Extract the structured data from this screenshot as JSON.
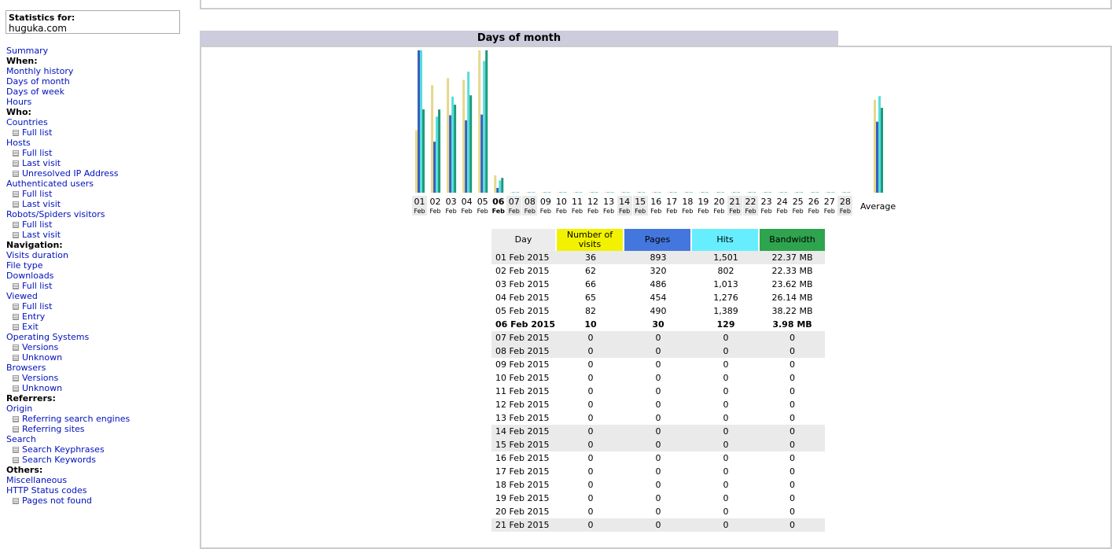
{
  "stats_for": {
    "label": "Statistics for:",
    "site": "huguka.com"
  },
  "nav": [
    {
      "text": "Summary",
      "type": "link"
    },
    {
      "text": "When:",
      "type": "head"
    },
    {
      "text": "Monthly history",
      "type": "link"
    },
    {
      "text": "Days of month",
      "type": "link"
    },
    {
      "text": "Days of week",
      "type": "link"
    },
    {
      "text": "Hours",
      "type": "link"
    },
    {
      "text": "Who:",
      "type": "head"
    },
    {
      "text": "Countries",
      "type": "link"
    },
    {
      "text": "Full list",
      "type": "sub"
    },
    {
      "text": "Hosts",
      "type": "link"
    },
    {
      "text": "Full list",
      "type": "sub"
    },
    {
      "text": "Last visit",
      "type": "sub"
    },
    {
      "text": "Unresolved IP Address",
      "type": "sub"
    },
    {
      "text": "Authenticated users",
      "type": "link"
    },
    {
      "text": "Full list",
      "type": "sub"
    },
    {
      "text": "Last visit",
      "type": "sub"
    },
    {
      "text": "Robots/Spiders visitors",
      "type": "link"
    },
    {
      "text": "Full list",
      "type": "sub"
    },
    {
      "text": "Last visit",
      "type": "sub"
    },
    {
      "text": "Navigation:",
      "type": "head"
    },
    {
      "text": "Visits duration",
      "type": "link"
    },
    {
      "text": "File type",
      "type": "link"
    },
    {
      "text": "Downloads",
      "type": "link"
    },
    {
      "text": "Full list",
      "type": "sub"
    },
    {
      "text": "Viewed",
      "type": "link"
    },
    {
      "text": "Full list",
      "type": "sub"
    },
    {
      "text": "Entry",
      "type": "sub"
    },
    {
      "text": "Exit",
      "type": "sub"
    },
    {
      "text": "Operating Systems",
      "type": "link"
    },
    {
      "text": "Versions",
      "type": "sub"
    },
    {
      "text": "Unknown",
      "type": "sub"
    },
    {
      "text": "Browsers",
      "type": "link"
    },
    {
      "text": "Versions",
      "type": "sub"
    },
    {
      "text": "Unknown",
      "type": "sub"
    },
    {
      "text": "Referrers:",
      "type": "head"
    },
    {
      "text": "Origin",
      "type": "link"
    },
    {
      "text": "Referring search engines",
      "type": "sub"
    },
    {
      "text": "Referring sites",
      "type": "sub"
    },
    {
      "text": "Search",
      "type": "link"
    },
    {
      "text": "Search Keyphrases",
      "type": "sub"
    },
    {
      "text": "Search Keywords",
      "type": "sub"
    },
    {
      "text": "Others:",
      "type": "head"
    },
    {
      "text": "Miscellaneous",
      "type": "link"
    },
    {
      "text": "HTTP Status codes",
      "type": "link"
    },
    {
      "text": "Pages not found",
      "type": "sub"
    }
  ],
  "section_title": "Days of month",
  "chart_data": {
    "type": "bar",
    "categories": [
      "01",
      "02",
      "03",
      "04",
      "05",
      "06",
      "07",
      "08",
      "09",
      "10",
      "11",
      "12",
      "13",
      "14",
      "15",
      "16",
      "17",
      "18",
      "19",
      "20",
      "21",
      "22",
      "23",
      "24",
      "25",
      "26",
      "27",
      "28"
    ],
    "category_sublabel": "Feb",
    "weekend_days": [
      "01",
      "07",
      "08",
      "14",
      "15",
      "21",
      "22",
      "28"
    ],
    "highlight_day": "06",
    "average_label": "Average",
    "series": [
      {
        "name": "Number of visits",
        "color": "#e6d88a",
        "values": [
          36,
          62,
          66,
          65,
          82,
          10,
          0,
          0,
          0,
          0,
          0,
          0,
          0,
          0,
          0,
          0,
          0,
          0,
          0,
          0,
          0,
          0,
          0,
          0,
          0,
          0,
          0,
          0
        ],
        "average": 53.5
      },
      {
        "name": "Pages",
        "color": "#3a5fbd",
        "values": [
          893,
          320,
          486,
          454,
          490,
          30,
          0,
          0,
          0,
          0,
          0,
          0,
          0,
          0,
          0,
          0,
          0,
          0,
          0,
          0,
          0,
          0,
          0,
          0,
          0,
          0,
          0,
          0
        ],
        "average": 445.5
      },
      {
        "name": "Hits",
        "color": "#55dddd",
        "values": [
          1501,
          802,
          1013,
          1276,
          1389,
          129,
          0,
          0,
          0,
          0,
          0,
          0,
          0,
          0,
          0,
          0,
          0,
          0,
          0,
          0,
          0,
          0,
          0,
          0,
          0,
          0,
          0,
          0
        ],
        "average": 1018.3
      },
      {
        "name": "Bandwidth",
        "color": "#1d9a7a",
        "values": [
          22.37,
          22.33,
          23.62,
          26.14,
          38.22,
          3.98,
          0,
          0,
          0,
          0,
          0,
          0,
          0,
          0,
          0,
          0,
          0,
          0,
          0,
          0,
          0,
          0,
          0,
          0,
          0,
          0,
          0,
          0
        ],
        "average": 22.78
      }
    ]
  },
  "table": {
    "headers": {
      "day": "Day",
      "visits": "Number of visits",
      "pages": "Pages",
      "hits": "Hits",
      "bandwidth": "Bandwidth"
    },
    "rows": [
      {
        "day": "01 Feb 2015",
        "visits": "36",
        "pages": "893",
        "hits": "1,501",
        "bandwidth": "22.37 MB",
        "weekend": true
      },
      {
        "day": "02 Feb 2015",
        "visits": "62",
        "pages": "320",
        "hits": "802",
        "bandwidth": "22.33 MB"
      },
      {
        "day": "03 Feb 2015",
        "visits": "66",
        "pages": "486",
        "hits": "1,013",
        "bandwidth": "23.62 MB"
      },
      {
        "day": "04 Feb 2015",
        "visits": "65",
        "pages": "454",
        "hits": "1,276",
        "bandwidth": "26.14 MB"
      },
      {
        "day": "05 Feb 2015",
        "visits": "82",
        "pages": "490",
        "hits": "1,389",
        "bandwidth": "38.22 MB"
      },
      {
        "day": "06 Feb 2015",
        "visits": "10",
        "pages": "30",
        "hits": "129",
        "bandwidth": "3.98 MB",
        "today": true
      },
      {
        "day": "07 Feb 2015",
        "visits": "0",
        "pages": "0",
        "hits": "0",
        "bandwidth": "0",
        "weekend": true
      },
      {
        "day": "08 Feb 2015",
        "visits": "0",
        "pages": "0",
        "hits": "0",
        "bandwidth": "0",
        "weekend": true
      },
      {
        "day": "09 Feb 2015",
        "visits": "0",
        "pages": "0",
        "hits": "0",
        "bandwidth": "0"
      },
      {
        "day": "10 Feb 2015",
        "visits": "0",
        "pages": "0",
        "hits": "0",
        "bandwidth": "0"
      },
      {
        "day": "11 Feb 2015",
        "visits": "0",
        "pages": "0",
        "hits": "0",
        "bandwidth": "0"
      },
      {
        "day": "12 Feb 2015",
        "visits": "0",
        "pages": "0",
        "hits": "0",
        "bandwidth": "0"
      },
      {
        "day": "13 Feb 2015",
        "visits": "0",
        "pages": "0",
        "hits": "0",
        "bandwidth": "0"
      },
      {
        "day": "14 Feb 2015",
        "visits": "0",
        "pages": "0",
        "hits": "0",
        "bandwidth": "0",
        "weekend": true
      },
      {
        "day": "15 Feb 2015",
        "visits": "0",
        "pages": "0",
        "hits": "0",
        "bandwidth": "0",
        "weekend": true
      },
      {
        "day": "16 Feb 2015",
        "visits": "0",
        "pages": "0",
        "hits": "0",
        "bandwidth": "0"
      },
      {
        "day": "17 Feb 2015",
        "visits": "0",
        "pages": "0",
        "hits": "0",
        "bandwidth": "0"
      },
      {
        "day": "18 Feb 2015",
        "visits": "0",
        "pages": "0",
        "hits": "0",
        "bandwidth": "0"
      },
      {
        "day": "19 Feb 2015",
        "visits": "0",
        "pages": "0",
        "hits": "0",
        "bandwidth": "0"
      },
      {
        "day": "20 Feb 2015",
        "visits": "0",
        "pages": "0",
        "hits": "0",
        "bandwidth": "0"
      },
      {
        "day": "21 Feb 2015",
        "visits": "0",
        "pages": "0",
        "hits": "0",
        "bandwidth": "0",
        "weekend": true
      }
    ]
  }
}
